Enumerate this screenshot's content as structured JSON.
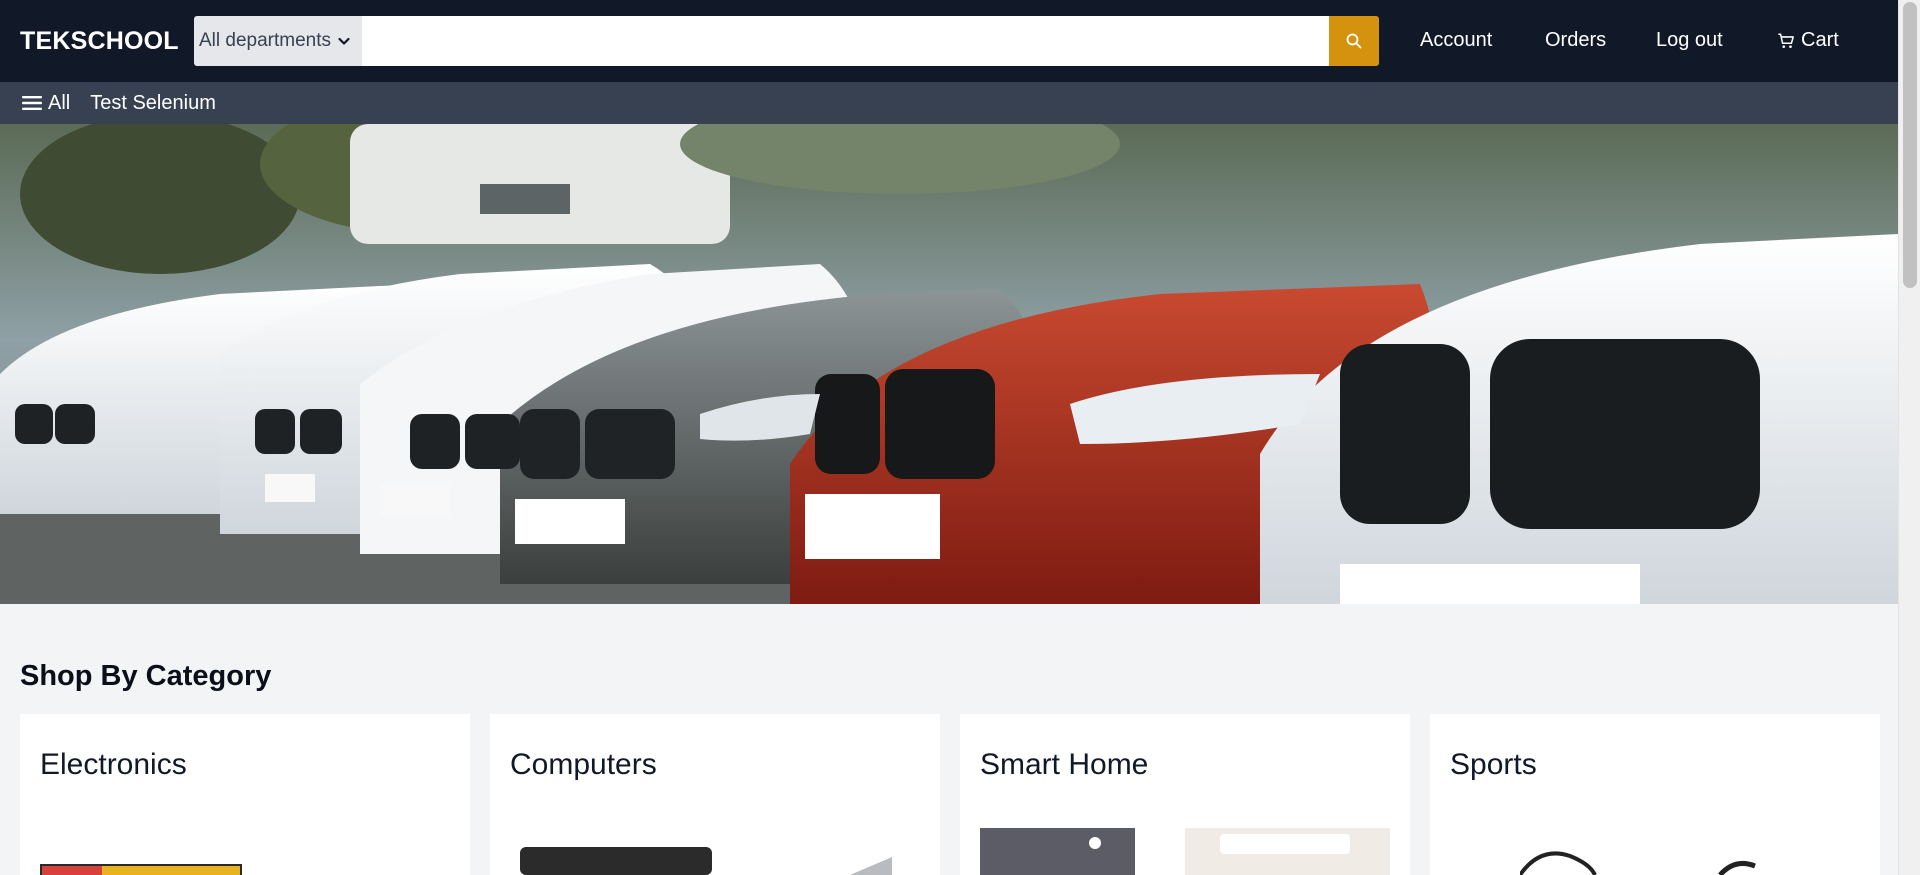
{
  "header": {
    "logo": "TEKSCHOOL",
    "department_selected": "All departments",
    "search_value": "",
    "search_placeholder": "",
    "nav": {
      "account": "Account",
      "orders": "Orders",
      "logout": "Log out",
      "cart": "Cart"
    }
  },
  "subnav": {
    "all": "All",
    "items": [
      "Test Selenium"
    ]
  },
  "hero": {
    "image": "row-of-parked-cars"
  },
  "category_section": {
    "title": "Shop By Category",
    "cards": [
      {
        "title": "Electronics"
      },
      {
        "title": "Computers"
      },
      {
        "title": "Smart Home"
      },
      {
        "title": "Sports"
      }
    ]
  },
  "colors": {
    "header_bg": "#111827",
    "subnav_bg": "#374151",
    "accent": "#d4920f",
    "page_bg": "#f3f4f6"
  }
}
